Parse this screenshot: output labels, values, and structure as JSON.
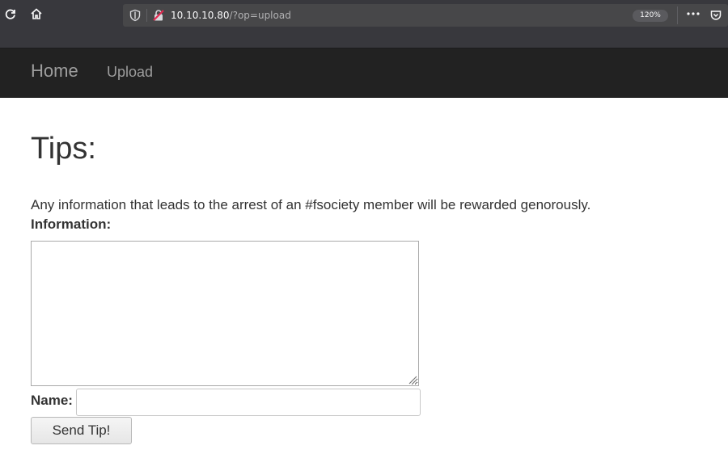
{
  "browser": {
    "url_host": "10.10.10.80",
    "url_path": "/?op=upload",
    "zoom": "120%",
    "icons": {
      "reload": "reload-icon",
      "home": "home-icon",
      "shield": "shield-icon",
      "insecure_lock": "insecure-lock-icon",
      "page_actions": "more-horizontal-icon",
      "pocket": "pocket-icon"
    }
  },
  "navbar": {
    "brand": "Home",
    "links": [
      "Upload"
    ]
  },
  "main": {
    "title": "Tips:",
    "intro": "Any information that leads to the arrest of an #fsociety member will be rewarded genorously.",
    "information_label": "Information:",
    "information_value": "",
    "name_label": "Name:",
    "name_value": "",
    "submit_label": "Send Tip!"
  }
}
